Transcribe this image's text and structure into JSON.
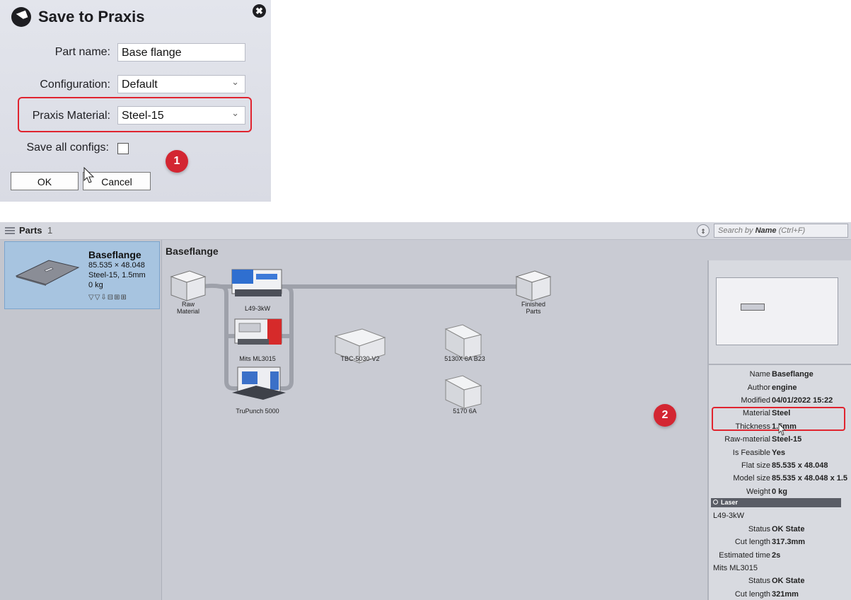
{
  "dialog": {
    "title": "Save to Praxis",
    "close_glyph": "✖",
    "part_name_label": "Part name:",
    "part_name_value": "Base flange",
    "configuration_label": "Configuration:",
    "configuration_value": "Default",
    "material_label": "Praxis  Material:",
    "material_value": "Steel-15",
    "save_all_label": "Save all configs:",
    "ok_label": "OK",
    "cancel_label": "Cancel",
    "callout": "1"
  },
  "app": {
    "parts_label": "Parts",
    "parts_count": "1",
    "sort_glyph": "⇕",
    "search_prefix": "Search by",
    "search_bold": "Name",
    "search_suffix": "(Ctrl+F)",
    "part_card": {
      "name": "Baseflange",
      "dims": "85.535 × 48.048",
      "material": "Steel-15, 1.5mm",
      "weight": "0 kg",
      "icons": "▽▽⇩⊟⊞⊞"
    },
    "flow": {
      "title": "Baseflange",
      "machines": [
        {
          "label": "Raw\nMaterial"
        },
        {
          "label": "L49-3kW"
        },
        {
          "label": "Mits ML3015"
        },
        {
          "label": "TruPunch 5000"
        },
        {
          "label": "TBC-5030-V2"
        },
        {
          "label": "5130X 6A B23"
        },
        {
          "label": "5170 6A"
        },
        {
          "label": "Finished\nParts"
        }
      ]
    },
    "properties": [
      {
        "k": "Name",
        "v": "Baseflange"
      },
      {
        "k": "Author",
        "v": "engine"
      },
      {
        "k": "Modified",
        "v": "04/01/2022 15:22"
      },
      {
        "k": "Material",
        "v": "Steel"
      },
      {
        "k": "Thickness",
        "v": "1.5mm"
      },
      {
        "k": "Raw-material",
        "v": "Steel-15"
      },
      {
        "k": "Is Feasible",
        "v": "Yes"
      },
      {
        "k": "Flat size",
        "v": "85.535 x 48.048"
      },
      {
        "k": "Model size",
        "v": "85.535 x 48.048 x 1.5"
      },
      {
        "k": "Weight",
        "v": "0 kg"
      }
    ],
    "laser_section": "Laser",
    "laser_rows": {
      "machine1": "L49-3kW",
      "status1_k": "Status",
      "status1_v": "OK State",
      "cut1_k": "Cut length",
      "cut1_v": "317.3mm",
      "time_k": "Estimated time",
      "time_v": "2s",
      "machine2": "Mits ML3015",
      "status2_k": "Status",
      "status2_v": "OK State",
      "cut2_k": "Cut length",
      "cut2_v": "321mm"
    },
    "callout": "2"
  },
  "colors": {
    "highlight": "#e0242f",
    "callout": "#d32632",
    "selected_card": "#a7c4e0"
  }
}
